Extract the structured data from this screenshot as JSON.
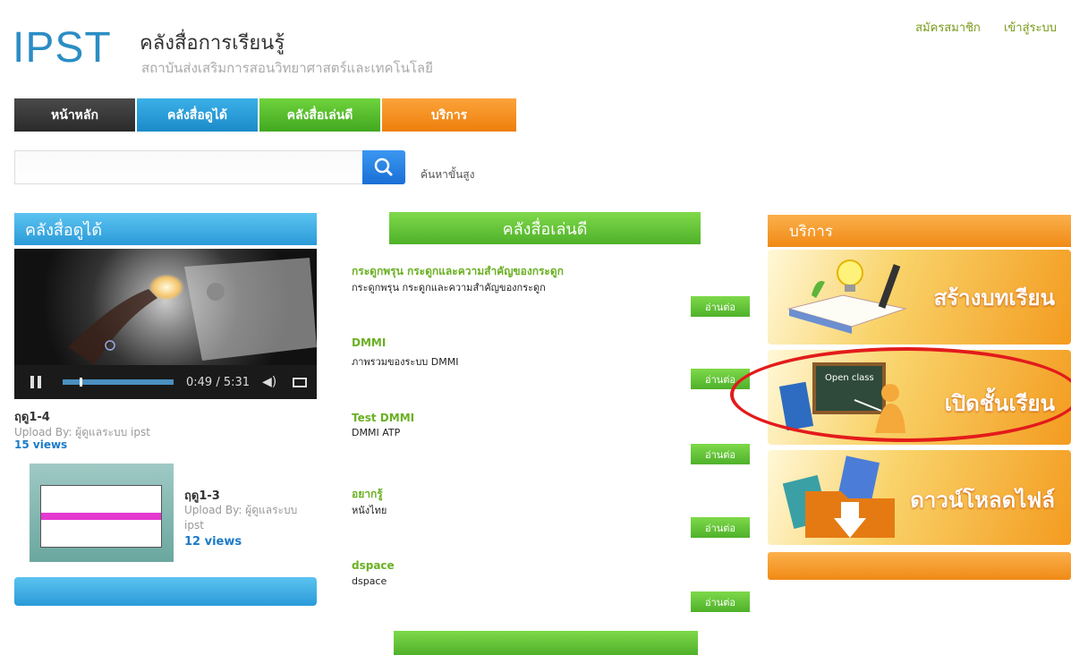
{
  "header": {
    "logo": "IPST",
    "title": "คลังสื่อการเรียนรู้",
    "subtitle": "สถาบันส่งเสริมการสอนวิทยาศาสตร์และเทคโนโลยี",
    "register": "สมัครสมาชิก",
    "login": "เข้าสู่ระบบ"
  },
  "nav": {
    "home": "หน้าหลัก",
    "watch": "คลังสื่อดูได้",
    "play": "คลังสื่อเล่นดี",
    "service": "บริการ"
  },
  "search": {
    "value": "",
    "advanced": "ค้นหาขั้นสูง"
  },
  "watch": {
    "heading": "คลังสื่อดูได้",
    "player": {
      "time": "0:49 / 5:31",
      "progress": 0.15
    },
    "videos": [
      {
        "title": "ฤดู1-4",
        "upload": "Upload By: ผู้ดูแลระบบ ipst",
        "views": "15 views"
      },
      {
        "title": "ฤดู1-3",
        "upload": "Upload By: ผู้ดูแลระบบ ipst",
        "views": "12 views"
      }
    ]
  },
  "play": {
    "heading": "คลังสื่อเล่นดี",
    "read_more": "อ่านต่อ",
    "items": [
      {
        "title": "กระดูกพรุน กระดูกและความสำคัญของกระดูก",
        "desc": "กระดูกพรุน กระดูกและความสำคัญของกระดูก"
      },
      {
        "title": "DMMI",
        "desc": "ภาพรวมของระบบ DMMI"
      },
      {
        "title": "Test DMMI",
        "desc": "DMMI ATP"
      },
      {
        "title": "อยากรู้",
        "desc": "หนังไทย"
      },
      {
        "title": "dspace",
        "desc": "dspace"
      }
    ]
  },
  "service": {
    "heading": "บริการ",
    "create": "สร้างบทเรียน",
    "open": "เปิดชั้นเรียน",
    "open_board": "Open class",
    "download": "ดาวน์โหลดไฟล์"
  },
  "colors": {
    "blue": "#2a9ad8",
    "green": "#4fb12a",
    "orange": "#f08a16",
    "highlight": "#e31b1b"
  }
}
